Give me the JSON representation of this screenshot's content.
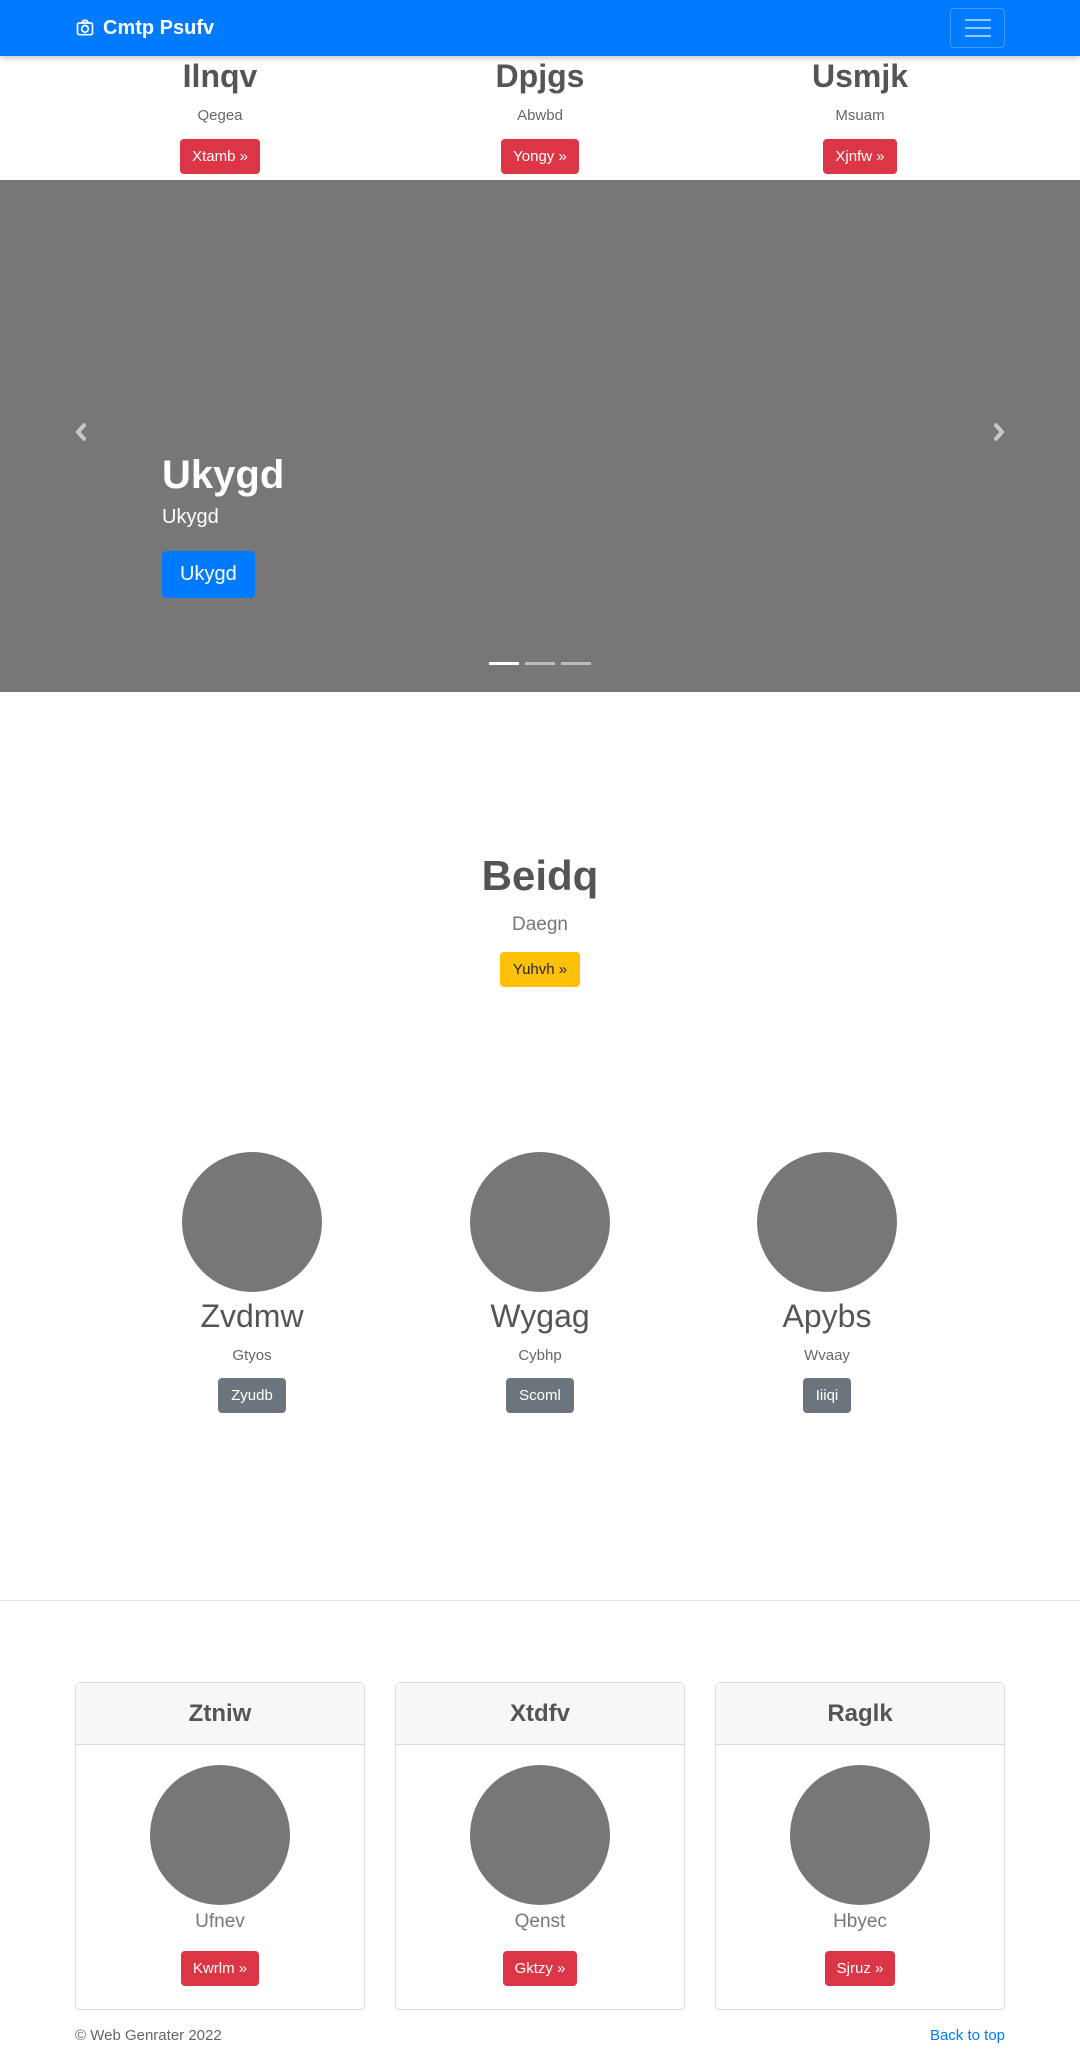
{
  "navbar": {
    "brand": "Cmtp Psufv",
    "brand_icon": "camera-icon",
    "toggler_icon": "hamburger-icon"
  },
  "top_row": [
    {
      "title": "Ilnqv",
      "text": "Qegea",
      "button": "Xtamb »"
    },
    {
      "title": "Dpjgs",
      "text": "Abwbd",
      "button": "Yongy »"
    },
    {
      "title": "Usmjk",
      "text": "Msuam",
      "button": "Xjnfw »"
    }
  ],
  "carousel": {
    "title": "Ukygd",
    "subtitle": "Ukygd",
    "button": "Ukygd",
    "prev_icon": "chevron-left-icon",
    "next_icon": "chevron-right-icon",
    "slides": 3,
    "active_slide": 1
  },
  "hero": {
    "title": "Beidq",
    "text": "Daegn",
    "button": "Yuhvh »"
  },
  "circles": [
    {
      "title": "Zvdmw",
      "text": "Gtyos",
      "button": "Zyudb"
    },
    {
      "title": "Wygag",
      "text": "Cybhp",
      "button": "Scoml"
    },
    {
      "title": "Apybs",
      "text": "Wvaay",
      "button": "Iiiqi"
    }
  ],
  "cards": [
    {
      "header": "Ztniw",
      "text": "Ufnev",
      "button": "Kwrlm »"
    },
    {
      "header": "Xtdfv",
      "text": "Qenst",
      "button": "Gktzy »"
    },
    {
      "header": "Raglk",
      "text": "Hbyec",
      "button": "Sjruz »"
    }
  ],
  "footer": {
    "copyright": "© Web Genrater 2022",
    "back_to_top": "Back to top"
  },
  "colors": {
    "primary": "#007bff",
    "danger": "#dc3545",
    "warning": "#ffc107",
    "secondary": "#6c757d",
    "placeholder_gray": "#777777"
  }
}
